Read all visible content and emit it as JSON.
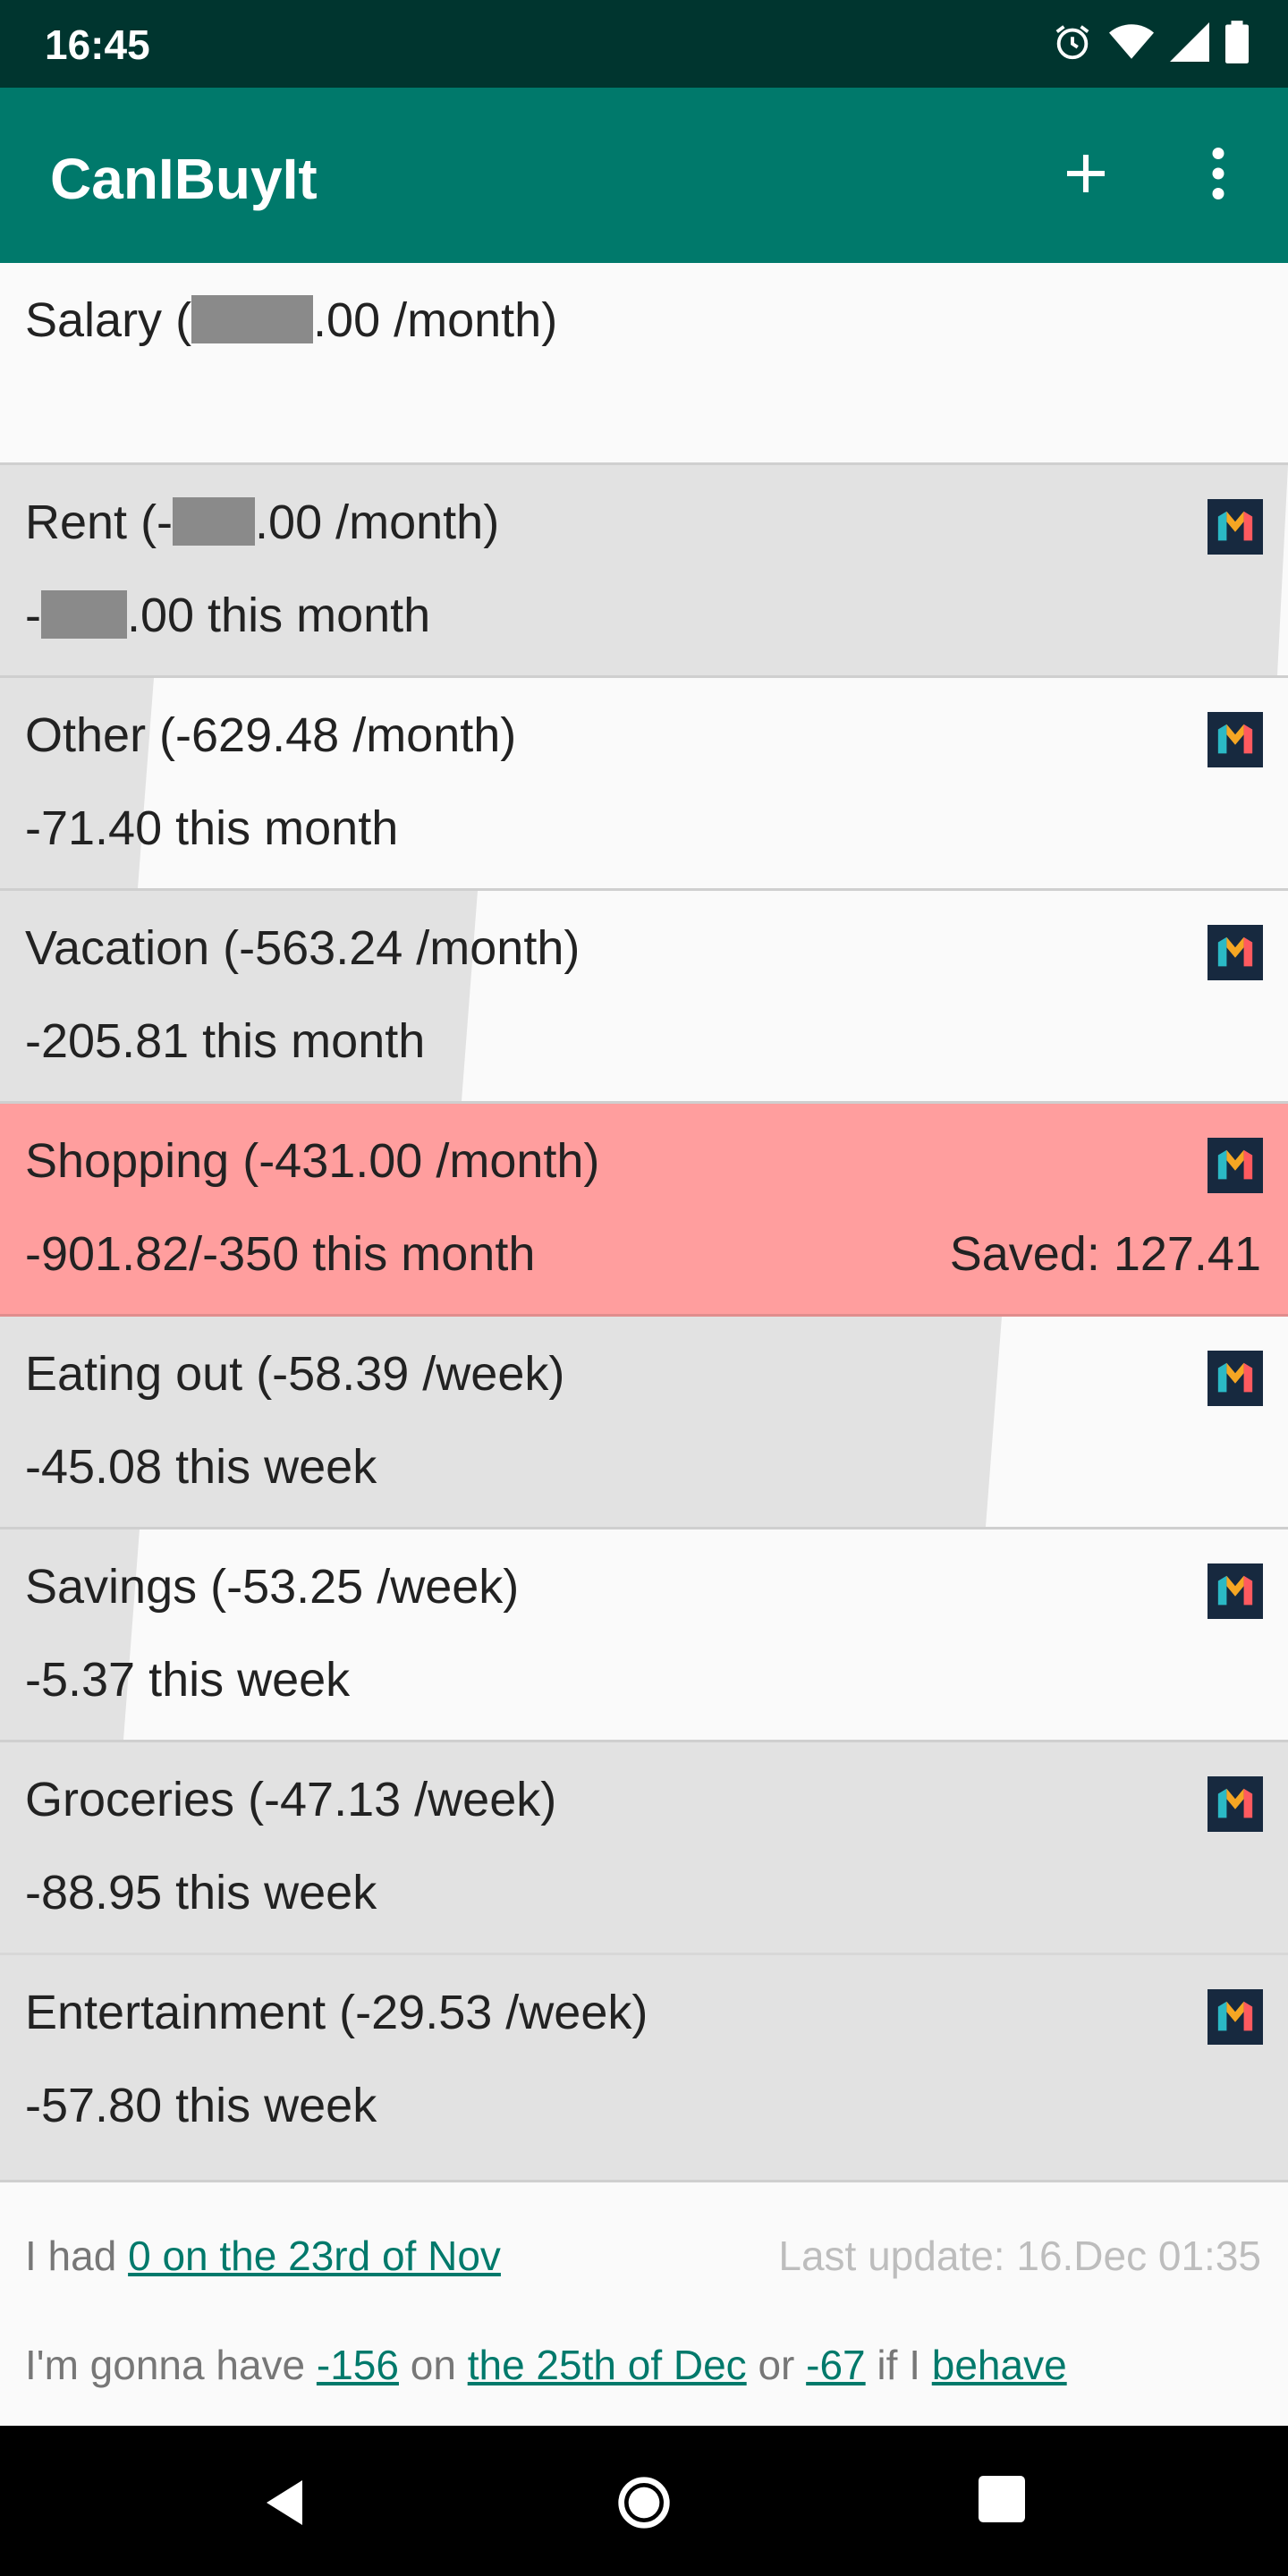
{
  "status_bar": {
    "time": "16:45",
    "icons": [
      "alarm-icon",
      "wifi-icon",
      "signal-icon",
      "battery-icon"
    ]
  },
  "app_bar": {
    "title": "CanIBuyIt",
    "actions": [
      "add-icon",
      "more-vert-icon"
    ]
  },
  "colors": {
    "status_bar": "#00352f",
    "app_bar": "#00796b",
    "over_budget": "#ff9e9e",
    "progress_fill": "#e2e2e2",
    "row_bg": "#fafafa",
    "link": "#00796b"
  },
  "salary": {
    "label_prefix": "Salary (",
    "label_suffix": ".00 /month)"
  },
  "rent": {
    "label_prefix": "Rent (-",
    "label_suffix": ".00 /month)",
    "spent_prefix": "-",
    "spent_suffix": ".00 this month",
    "progress": 0.99
  },
  "categories": [
    {
      "id": "other",
      "label": "Other (-629.48 /month)",
      "spent": "-71.40 this month",
      "progress": 0.11
    },
    {
      "id": "vacation",
      "label": "Vacation (-563.24 /month)",
      "spent": "-205.81 this month",
      "progress": 0.37
    },
    {
      "id": "shopping",
      "label": "Shopping (-431.00 /month)",
      "spent": "-901.82/-350 this month",
      "saved": "Saved: 127.41",
      "over_budget": true
    },
    {
      "id": "eating-out",
      "label": "Eating out (-58.39 /week)",
      "spent": "-45.08 this week",
      "progress": 0.77
    },
    {
      "id": "savings",
      "label": "Savings (-53.25 /week)",
      "spent": "-5.37 this week",
      "progress": 0.1
    },
    {
      "id": "groceries",
      "label": "Groceries (-47.13 /week)",
      "spent": "-88.95 this week",
      "progress": 1.0
    },
    {
      "id": "entertainment",
      "label": "Entertainment (-29.53 /week)",
      "spent": "-57.80 this week",
      "progress": 1.0
    }
  ],
  "footer": {
    "had_prefix": "I had ",
    "had_link": "0 on the 23rd of Nov",
    "last_update": "Last update: 16.Dec 01:35",
    "gonna_prefix": "I'm gonna have ",
    "gonna_amount": "-156",
    "on_word": " on ",
    "date_link": "the 25th of Dec",
    "or_word": " or ",
    "behave_amount": "-67",
    "if_word": " if I ",
    "behave_link": "behave"
  },
  "nav_bar": {
    "buttons": [
      "back-icon",
      "home-icon",
      "recents-icon"
    ]
  }
}
